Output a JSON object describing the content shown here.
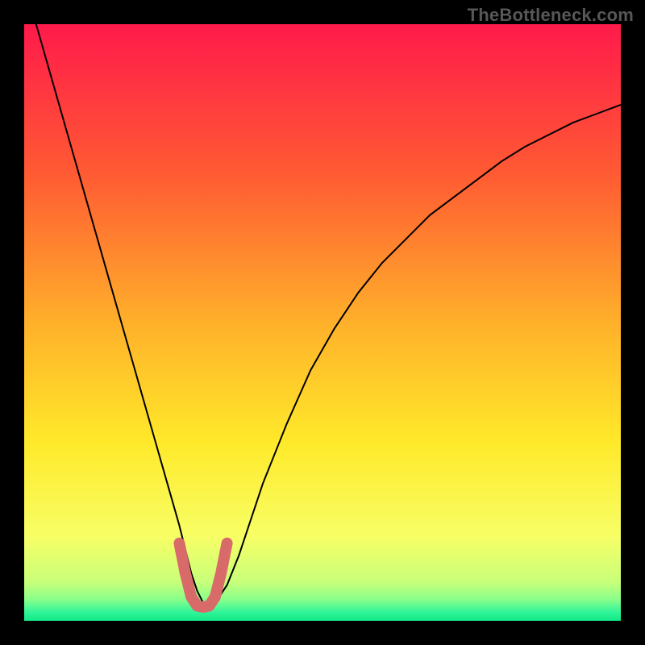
{
  "watermark": "TheBottleneck.com",
  "chart_data": {
    "type": "line",
    "title": "",
    "xlabel": "",
    "ylabel": "",
    "xlim": [
      0,
      100
    ],
    "ylim": [
      0,
      100
    ],
    "grid": false,
    "legend": false,
    "background_gradient": {
      "orientation": "vertical",
      "stops": [
        {
          "pos": 0.0,
          "color": "#ff1a4b"
        },
        {
          "pos": 0.25,
          "color": "#ff5a33"
        },
        {
          "pos": 0.5,
          "color": "#ffb02a"
        },
        {
          "pos": 0.7,
          "color": "#ffe92a"
        },
        {
          "pos": 0.86,
          "color": "#f7ff66"
        },
        {
          "pos": 0.935,
          "color": "#c8ff7a"
        },
        {
          "pos": 0.965,
          "color": "#86ff8a"
        },
        {
          "pos": 0.985,
          "color": "#33f59a"
        },
        {
          "pos": 1.0,
          "color": "#12e887"
        }
      ]
    },
    "series": [
      {
        "name": "bottleneck-curve",
        "color": "#000000",
        "stroke_width": 2,
        "x": [
          2,
          4,
          6,
          8,
          10,
          12,
          14,
          16,
          18,
          20,
          22,
          24,
          26,
          27,
          28,
          29,
          30,
          31,
          32,
          34,
          36,
          38,
          40,
          44,
          48,
          52,
          56,
          60,
          64,
          68,
          72,
          76,
          80,
          84,
          88,
          92,
          96,
          100
        ],
        "y": [
          100,
          93,
          86,
          79,
          72,
          65,
          58,
          51,
          44,
          37,
          30,
          23,
          16,
          12,
          8,
          5,
          3,
          2.5,
          3,
          6,
          11,
          17,
          23,
          33,
          42,
          49,
          55,
          60,
          64,
          68,
          71,
          74,
          77,
          79.5,
          81.5,
          83.5,
          85,
          86.5
        ]
      },
      {
        "name": "bottom-marker",
        "color": "#d86a6a",
        "stroke_width": 14,
        "linecap": "round",
        "x": [
          26,
          27,
          28,
          29,
          30,
          31,
          32,
          33,
          34
        ],
        "y": [
          13,
          8,
          4,
          2.5,
          2.3,
          2.5,
          4,
          8,
          13
        ]
      }
    ],
    "annotations": []
  }
}
